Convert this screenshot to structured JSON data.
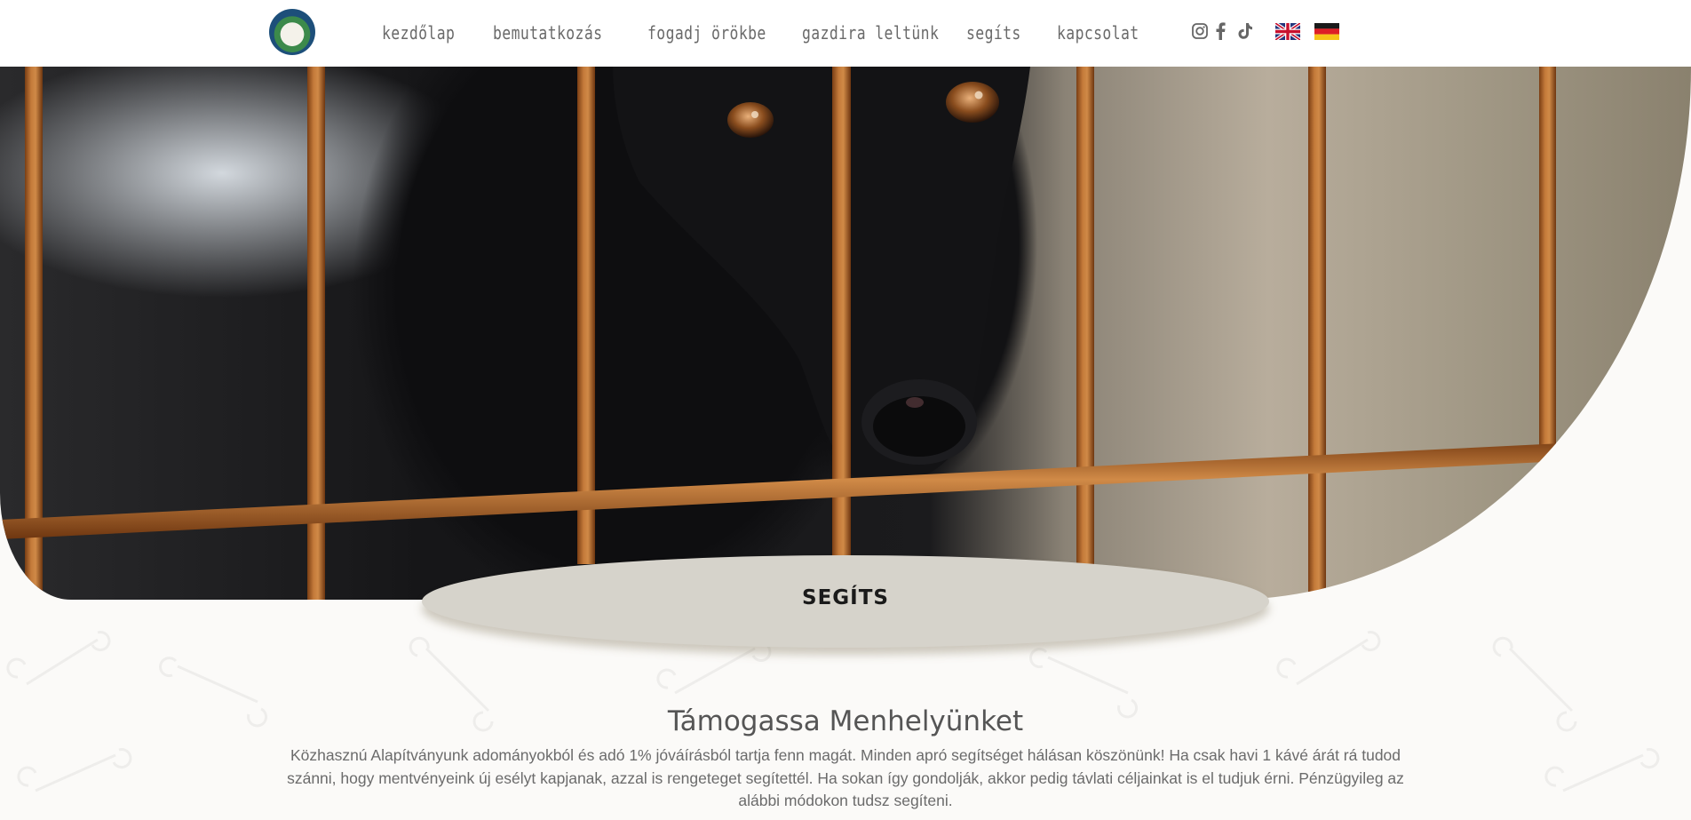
{
  "nav": {
    "items": [
      {
        "label": "Kezdőlap"
      },
      {
        "label": "Bemutatkozás"
      },
      {
        "label": "Fogadj örökbe"
      },
      {
        "label": "Gazdira leltünk"
      },
      {
        "label": "Segíts"
      },
      {
        "label": "Kapcsolat"
      }
    ]
  },
  "social": {
    "icons": [
      "instagram-icon",
      "facebook-icon",
      "tiktok-icon"
    ]
  },
  "languages": [
    "english-flag",
    "german-flag"
  ],
  "hero": {
    "label": "SEGÍTS"
  },
  "main": {
    "title": "Támogassa Menhelyünket",
    "body": "Közhasznú Alapítványunk adományokból és adó 1% jóváírásból tartja fenn magát. Minden apró segítséget hálásan köszönünk! Ha csak havi 1 kávé árát rá tudod szánni, hogy mentvényeink új esélyt kapjanak, azzal is rengeteget segítettél. Ha sokan így gondolják, akkor pedig távlati céljainkat is el tudjuk érni. Pénzügyileg az alábbi módokon tudsz segíteni."
  },
  "colors": {
    "nav_text": "#6a6a6a",
    "label_bg": "#d6d3cb",
    "rust": "#b0682d"
  }
}
